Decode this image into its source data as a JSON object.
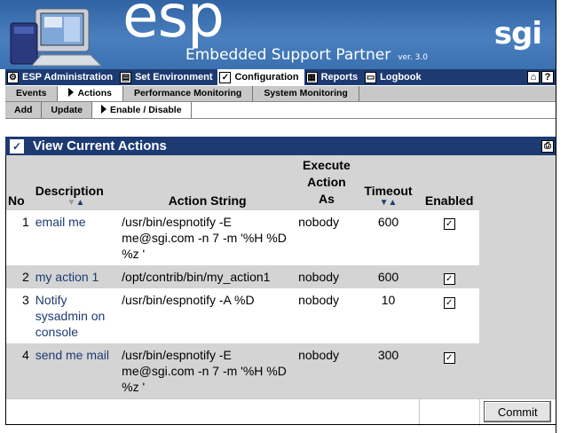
{
  "header": {
    "logo_text": "esp",
    "subtitle": "Embedded Support Partner",
    "version": "ver. 3.0",
    "brand": "sgi"
  },
  "main_nav": [
    {
      "label": "ESP Administration",
      "icon": "admin-icon"
    },
    {
      "label": "Set Environment",
      "icon": "environment-icon"
    },
    {
      "label": "Configuration",
      "icon": "checkmark-icon",
      "active": true
    },
    {
      "label": "Reports",
      "icon": "reports-icon"
    },
    {
      "label": "Logbook",
      "icon": "logbook-icon"
    }
  ],
  "sub_nav": [
    {
      "label": "Events"
    },
    {
      "label": "Actions",
      "active": true
    },
    {
      "label": "Performance Monitoring"
    },
    {
      "label": "System Monitoring"
    }
  ],
  "sub_nav2": [
    {
      "label": "Add"
    },
    {
      "label": "Update"
    },
    {
      "label": "Enable / Disable",
      "active": true
    }
  ],
  "panel": {
    "title": "View Current Actions"
  },
  "table": {
    "headers": {
      "no": "No",
      "description": "Description",
      "action_string": "Action String",
      "execute_as_1": "Execute",
      "execute_as_2": "Action",
      "execute_as_3": "As",
      "timeout": "Timeout",
      "enabled": "Enabled"
    },
    "rows": [
      {
        "no": "1",
        "description": "email me",
        "action": "/usr/bin/espnotify -E me@sgi.com -n 7 -m '%H %D %z '",
        "execute_as": "nobody",
        "timeout": "600",
        "enabled": "✓"
      },
      {
        "no": "2",
        "description": "my action 1",
        "action": "/opt/contrib/bin/my_action1",
        "execute_as": "nobody",
        "timeout": "600",
        "enabled": "✓"
      },
      {
        "no": "3",
        "description": "Notify sysadmin on console",
        "action": "/usr/bin/espnotify -A %D",
        "execute_as": "nobody",
        "timeout": "10",
        "enabled": "✓"
      },
      {
        "no": "4",
        "description": "send me mail",
        "action": "/usr/bin/espnotify -E me@sgi.com -n 7 -m '%H %D %z '",
        "execute_as": "nobody",
        "timeout": "300",
        "enabled": "✓"
      }
    ],
    "commit_label": "Commit"
  },
  "colors": {
    "nav_bg": "#1d3b72",
    "banner_bg": "#3a6dab",
    "row_gray": "#d4d4d4"
  }
}
